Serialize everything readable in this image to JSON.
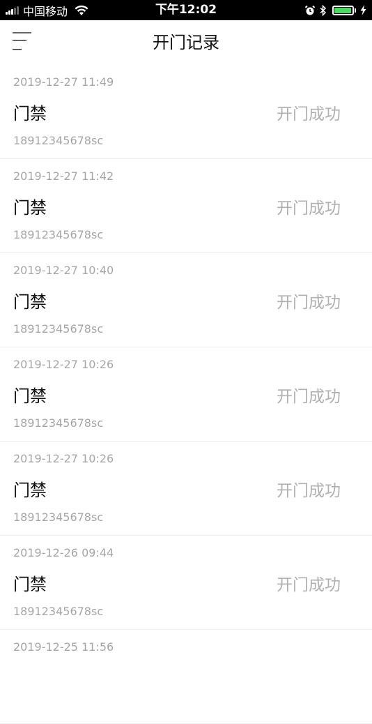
{
  "status_bar": {
    "carrier": "中国移动",
    "time": "下午12:02",
    "battery_level": 0.95,
    "battery_color": "#4cd964"
  },
  "header": {
    "menu_icon": "menu-icon",
    "title": "开门记录"
  },
  "records": [
    {
      "time": "2019-12-27 11:49",
      "name": "门禁",
      "status": "开门成功",
      "user": "18912345678sc"
    },
    {
      "time": "2019-12-27 11:42",
      "name": "门禁",
      "status": "开门成功",
      "user": "18912345678sc"
    },
    {
      "time": "2019-12-27 10:40",
      "name": "门禁",
      "status": "开门成功",
      "user": "18912345678sc"
    },
    {
      "time": "2019-12-27 10:26",
      "name": "门禁",
      "status": "开门成功",
      "user": "18912345678sc"
    },
    {
      "time": "2019-12-27 10:26",
      "name": "门禁",
      "status": "开门成功",
      "user": "18912345678sc"
    },
    {
      "time": "2019-12-26 09:44",
      "name": "门禁",
      "status": "开门成功",
      "user": "18912345678sc"
    },
    {
      "time": "2019-12-25 11:56",
      "name": "",
      "status": "",
      "user": ""
    }
  ]
}
